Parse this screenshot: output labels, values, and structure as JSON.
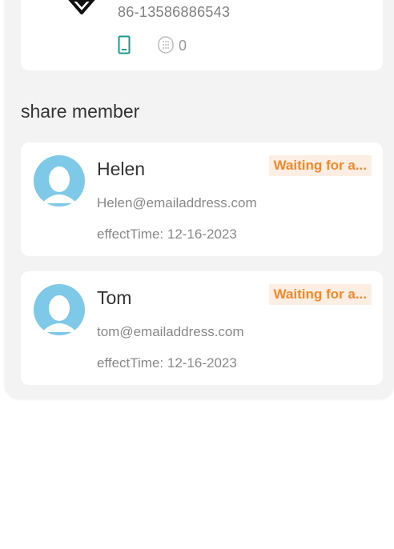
{
  "device": {
    "phone": "86-13586886543",
    "keypad_count": "0",
    "icons": [
      "device-logo-icon",
      "phone-icon",
      "keypad-icon"
    ]
  },
  "share_section": {
    "title": "share member"
  },
  "members": [
    {
      "name": "Helen",
      "email": "Helen@emailaddress.com",
      "effect_time": "effectTime: 12-16-2023",
      "status": "Waiting for a..."
    },
    {
      "name": "Tom",
      "email": "tom@emailaddress.com",
      "effect_time": "effectTime: 12-16-2023",
      "status": "Waiting for a..."
    }
  ],
  "colors": {
    "accent_teal": "#1a9a8a",
    "status_orange": "#f08a2e",
    "status_bg": "#fdeee4",
    "avatar_blue": "#7ec8e8",
    "panel_bg": "#f3f3f3"
  }
}
